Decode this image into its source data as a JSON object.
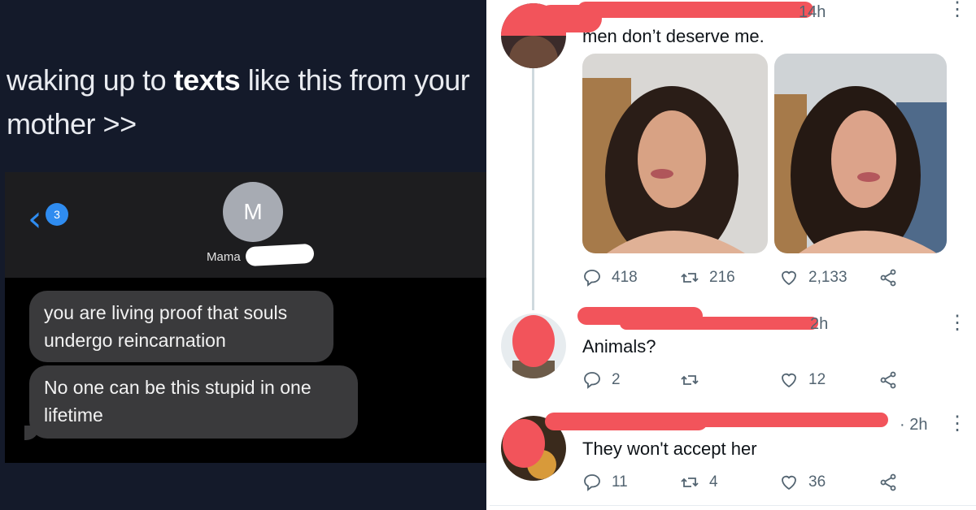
{
  "caption": {
    "prefix": "waking up to ",
    "bold": "texts",
    "suffix": " like this from your mother >>"
  },
  "sms": {
    "back_badge": "3",
    "avatar_letter": "M",
    "contact_name": "Mama",
    "messages": [
      "you are living proof that souls undergo reincarnation",
      "No one can be this stupid in one lifetime"
    ],
    "bubble_color": "#3a3a3c",
    "accent": "#2f8cf0"
  },
  "tweets": [
    {
      "time": "14h",
      "text": "men don’t deserve me.",
      "replies": "418",
      "retweets": "216",
      "likes": "2,133"
    },
    {
      "time": "2h",
      "text": "Animals?",
      "replies": "2",
      "retweets": "",
      "likes": "12"
    },
    {
      "time": "· 2h",
      "text": "They won't accept her",
      "replies": "11",
      "retweets": "4",
      "likes": "36"
    }
  ],
  "icons": [
    "back-chevron-icon",
    "reply-icon",
    "retweet-icon",
    "like-icon",
    "share-icon",
    "more-icon"
  ],
  "redaction_color": "#f2545b"
}
